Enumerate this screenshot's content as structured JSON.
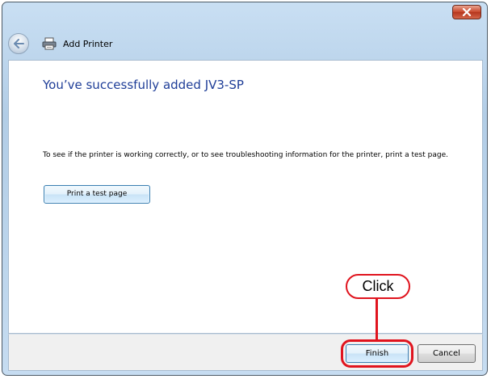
{
  "window": {
    "title": "Add Printer",
    "close_icon": "close-x-icon",
    "back_icon": "back-arrow-icon",
    "app_icon": "printer-icon"
  },
  "content": {
    "heading": "You’ve successfully added JV3-SP",
    "description": "To see if the printer is working correctly, or to see troubleshooting information for the printer, print a test page.",
    "print_test_label": "Print a test page"
  },
  "footer": {
    "finish_label": "Finish",
    "cancel_label": "Cancel"
  },
  "annotation": {
    "label": "Click",
    "color": "#e0141e"
  },
  "colors": {
    "heading": "#1f3e98",
    "chrome": "#b2cde6"
  }
}
